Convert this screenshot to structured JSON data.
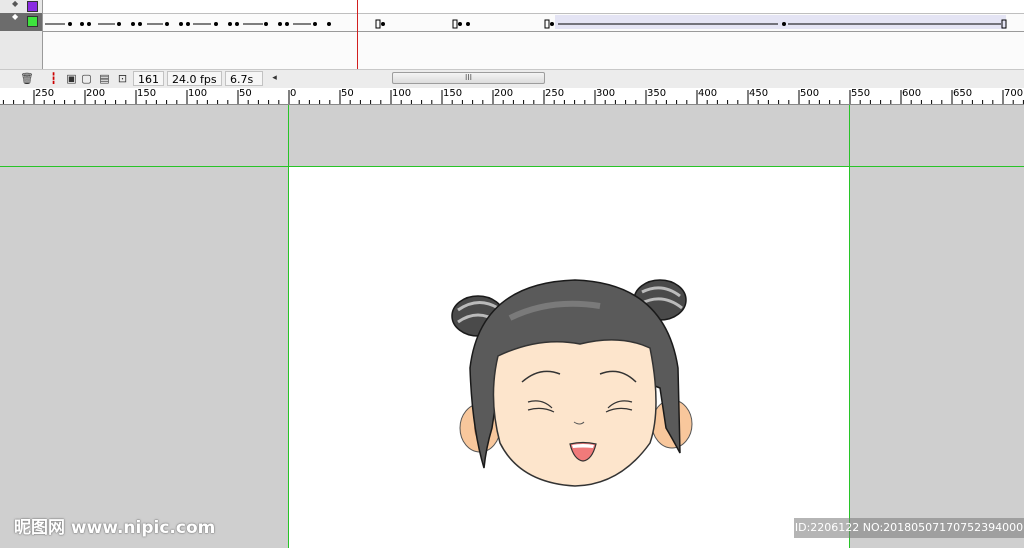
{
  "timeline": {
    "current_frame": "161",
    "frame_rate": "24.0 fps",
    "elapsed_time": "6.7s",
    "layers": [
      {
        "color": "#8a2be2"
      },
      {
        "color": "#3ee33e"
      }
    ],
    "scroll_left_arrow": "◂",
    "scroll_grip": "III"
  },
  "ruler": {
    "labels": [
      "250",
      "200",
      "150",
      "100",
      "50",
      "0",
      "50",
      "100",
      "150",
      "200",
      "250",
      "300",
      "350",
      "400",
      "450",
      "500",
      "550",
      "600",
      "650",
      "700"
    ]
  },
  "watermark": {
    "logo_text": "昵图网 www.nipic.com",
    "id_text": "ID:2206122 NO:20180507170752394000"
  },
  "colors": {
    "guide": "#27c427",
    "playhead": "#d21f1f",
    "stage": "#ffffff",
    "pasteboard": "#cfcfcf"
  }
}
